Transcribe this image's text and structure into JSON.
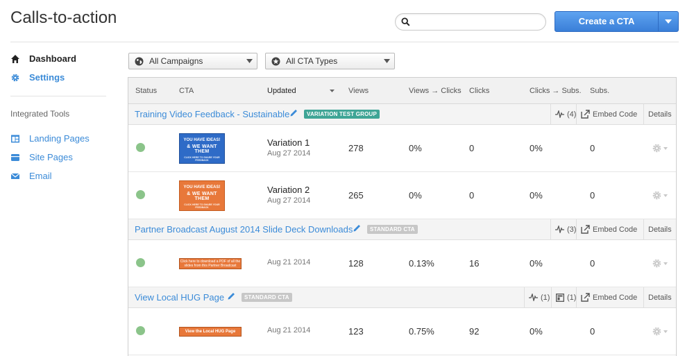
{
  "page": {
    "title": "Calls-to-action"
  },
  "search": {
    "placeholder": "",
    "value": ""
  },
  "create_button": {
    "label": "Create a CTA"
  },
  "sidebar": {
    "items": [
      {
        "label": "Dashboard",
        "icon": "home-icon"
      },
      {
        "label": "Settings",
        "icon": "gear-icon"
      }
    ],
    "section_heading": "Integrated Tools",
    "tools": [
      {
        "label": "Landing Pages",
        "icon": "landing-pages-icon"
      },
      {
        "label": "Site Pages",
        "icon": "site-pages-icon"
      },
      {
        "label": "Email",
        "icon": "email-icon"
      }
    ]
  },
  "filters": {
    "campaigns": "All Campaigns",
    "cta_types": "All CTA Types"
  },
  "table": {
    "columns": [
      "Status",
      "CTA",
      "Updated",
      "Views",
      "Views → Clicks",
      "Clicks",
      "Clicks → Subs.",
      "Subs."
    ],
    "groups": [
      {
        "name": "Training Video Feedback - Sustainable",
        "badge": "VARIATION TEST GROUP",
        "activity_count": "(4)",
        "embed_label": "Embed Code",
        "details_label": "Details",
        "rows": [
          {
            "thumb_line1": "YOU HAVE IDEAS!",
            "thumb_line2": "& WE WANT THEM",
            "thumb_line3": "CLICK HERE TO SHARE YOUR FEEDBACK",
            "title": "Variation 1",
            "date": "Aug 27 2014",
            "views": "278",
            "views_clicks": "0%",
            "clicks": "0",
            "clicks_subs": "0%",
            "subs": "0"
          },
          {
            "thumb_line1": "YOU HAVE IDEAS!",
            "thumb_line2": "& WE WANT THEM",
            "thumb_line3": "CLICK HERE TO SHARE YOUR FEEDBACK",
            "title": "Variation 2",
            "date": "Aug 27 2014",
            "views": "265",
            "views_clicks": "0%",
            "clicks": "0",
            "clicks_subs": "0%",
            "subs": "0"
          }
        ]
      },
      {
        "name": "Partner Broadcast August 2014 Slide Deck Downloads",
        "badge": "STANDARD CTA",
        "activity_count": "(3)",
        "embed_label": "Embed Code",
        "details_label": "Details",
        "rows": [
          {
            "thumb_text": "Click here to download a PDF of all the slides from this Partner Broadcast",
            "date": "Aug 21 2014",
            "views": "128",
            "views_clicks": "0.13%",
            "clicks": "16",
            "clicks_subs": "0%",
            "subs": "0"
          }
        ]
      },
      {
        "name": "View Local HUG Page",
        "badge": "STANDARD CTA",
        "activity_count": "(1)",
        "pages_count": "(1)",
        "embed_label": "Embed Code",
        "details_label": "Details",
        "rows": [
          {
            "thumb_text": "View the Local HUG Page",
            "date": "Aug 21 2014",
            "views": "123",
            "views_clicks": "0.75%",
            "clicks": "92",
            "clicks_subs": "0%",
            "subs": "0"
          }
        ]
      }
    ]
  },
  "colors": {
    "link": "#3b8bd8",
    "primary_button": "#3a7fd8",
    "variation_badge": "#3fa596",
    "standard_badge": "#c7c7c7",
    "status_active": "#8bc48a",
    "thumb_blue": "#2e6bc7",
    "thumb_orange": "#e8783a"
  }
}
